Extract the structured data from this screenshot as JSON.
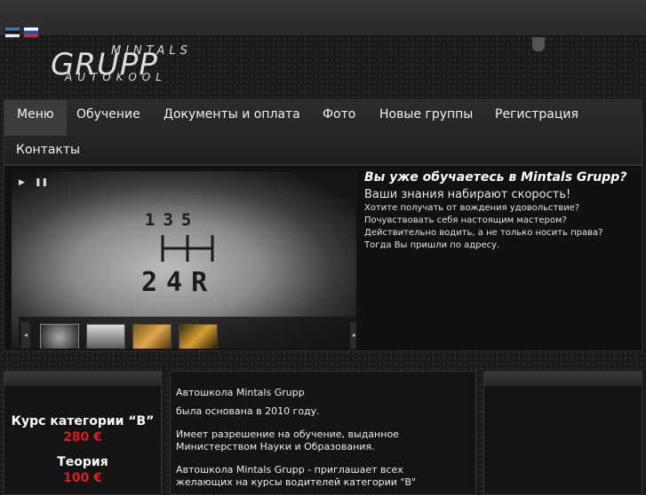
{
  "header": {
    "languages": [
      {
        "name": "estonian-flag-icon"
      },
      {
        "name": "russian-flag-icon"
      }
    ],
    "logo": {
      "top": "MINTALS",
      "main": "GRUPP",
      "sub": "AUTOKOOL"
    }
  },
  "nav": {
    "items": [
      {
        "label": "Меню"
      },
      {
        "label": "Обучение"
      },
      {
        "label": "Документы и оплата"
      },
      {
        "label": "Фото"
      },
      {
        "label": "Новые группы"
      },
      {
        "label": "Регистрация"
      },
      {
        "label": "Контакты"
      }
    ]
  },
  "slider": {
    "play_icon": "▶",
    "pause_icon": "❚❚",
    "gear_top": "135",
    "gear_bottom": "24R",
    "prev_icon": "◂",
    "next_icon": "▸",
    "title": "Вы уже обучаетесь в Mintals Grupp?",
    "subtitle": "Ваши знания набирают скорость!",
    "lines": [
      "Хотите получать от вождения удовольствие?",
      "Почувствовать себя настоящим мастером?",
      "Действительно водить, а не только носить права?",
      "Тогда Вы пришли по адресу."
    ]
  },
  "left_col": {
    "course_title": "Курс категории “B”",
    "course_price": "280 €",
    "theory_title": "Теория",
    "theory_price": "100 €"
  },
  "mid_col": {
    "lines": [
      "Автошкола Mintals Grupp",
      "была основана в 2010 году.",
      "Имеет разрешение на обучение, выданное",
      "Министерством Науки и Образования.",
      "Автошкола Mintals Grupp - приглашает всех",
      "желающих на курсы водителей категории \"B\""
    ]
  },
  "colors": {
    "accent_price": "#e01a1a",
    "background": "#1b1b1b"
  }
}
